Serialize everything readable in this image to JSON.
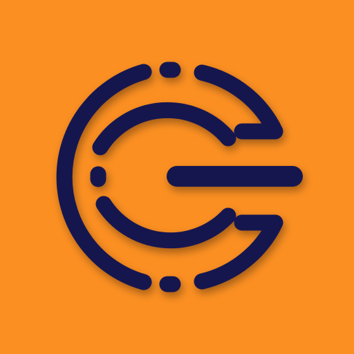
{
  "icon": {
    "name": "ring-power-logo-icon",
    "background_color": "#FB8F22",
    "stroke_color": "#131450"
  }
}
